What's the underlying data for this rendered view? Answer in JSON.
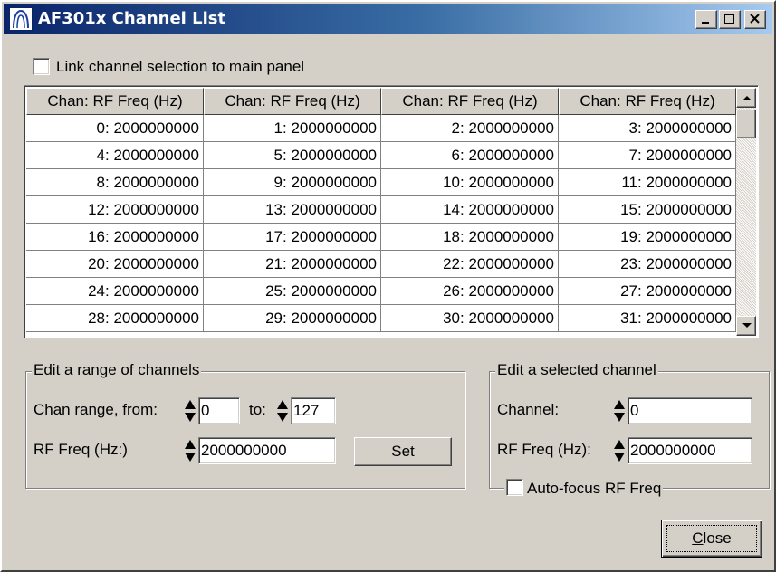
{
  "window": {
    "title": "AF301x Channel List"
  },
  "link_checkbox": {
    "label": "Link channel selection to main panel",
    "checked": false
  },
  "grid": {
    "header": "Chan: RF Freq (Hz)",
    "columns": [
      "Chan: RF Freq (Hz)",
      "Chan: RF Freq (Hz)",
      "Chan: RF Freq (Hz)",
      "Chan: RF Freq (Hz)"
    ],
    "rows": [
      [
        "0: 2000000000",
        "1: 2000000000",
        "2: 2000000000",
        "3: 2000000000"
      ],
      [
        "4: 2000000000",
        "5: 2000000000",
        "6: 2000000000",
        "7: 2000000000"
      ],
      [
        "8: 2000000000",
        "9: 2000000000",
        "10: 2000000000",
        "11: 2000000000"
      ],
      [
        "12: 2000000000",
        "13: 2000000000",
        "14: 2000000000",
        "15: 2000000000"
      ],
      [
        "16: 2000000000",
        "17: 2000000000",
        "18: 2000000000",
        "19: 2000000000"
      ],
      [
        "20: 2000000000",
        "21: 2000000000",
        "22: 2000000000",
        "23: 2000000000"
      ],
      [
        "24: 2000000000",
        "25: 2000000000",
        "26: 2000000000",
        "27: 2000000000"
      ],
      [
        "28: 2000000000",
        "29: 2000000000",
        "30: 2000000000",
        "31: 2000000000"
      ]
    ]
  },
  "range_group": {
    "title": "Edit a range of channels",
    "from_label": "Chan range, from:",
    "from_value": "0",
    "to_label": "to:",
    "to_value": "127",
    "freq_label": "RF Freq (Hz:)",
    "freq_value": "2000000000",
    "set_label": "Set"
  },
  "selected_group": {
    "title": "Edit a selected channel",
    "channel_label": "Channel:",
    "channel_value": "0",
    "freq_label": "RF Freq (Hz):",
    "freq_value": "2000000000",
    "autofocus_label": "Auto-focus RF Freq",
    "autofocus_checked": false
  },
  "close_button": {
    "accel": "C",
    "rest": "lose"
  },
  "colors": {
    "face": "#d4d0c8",
    "title_start": "#0a246a",
    "title_end": "#a6caf0"
  },
  "icons": [
    "app-icon",
    "minimize-icon",
    "maximize-icon",
    "close-icon",
    "scroll-up-icon",
    "scroll-down-icon",
    "spin-icon"
  ]
}
